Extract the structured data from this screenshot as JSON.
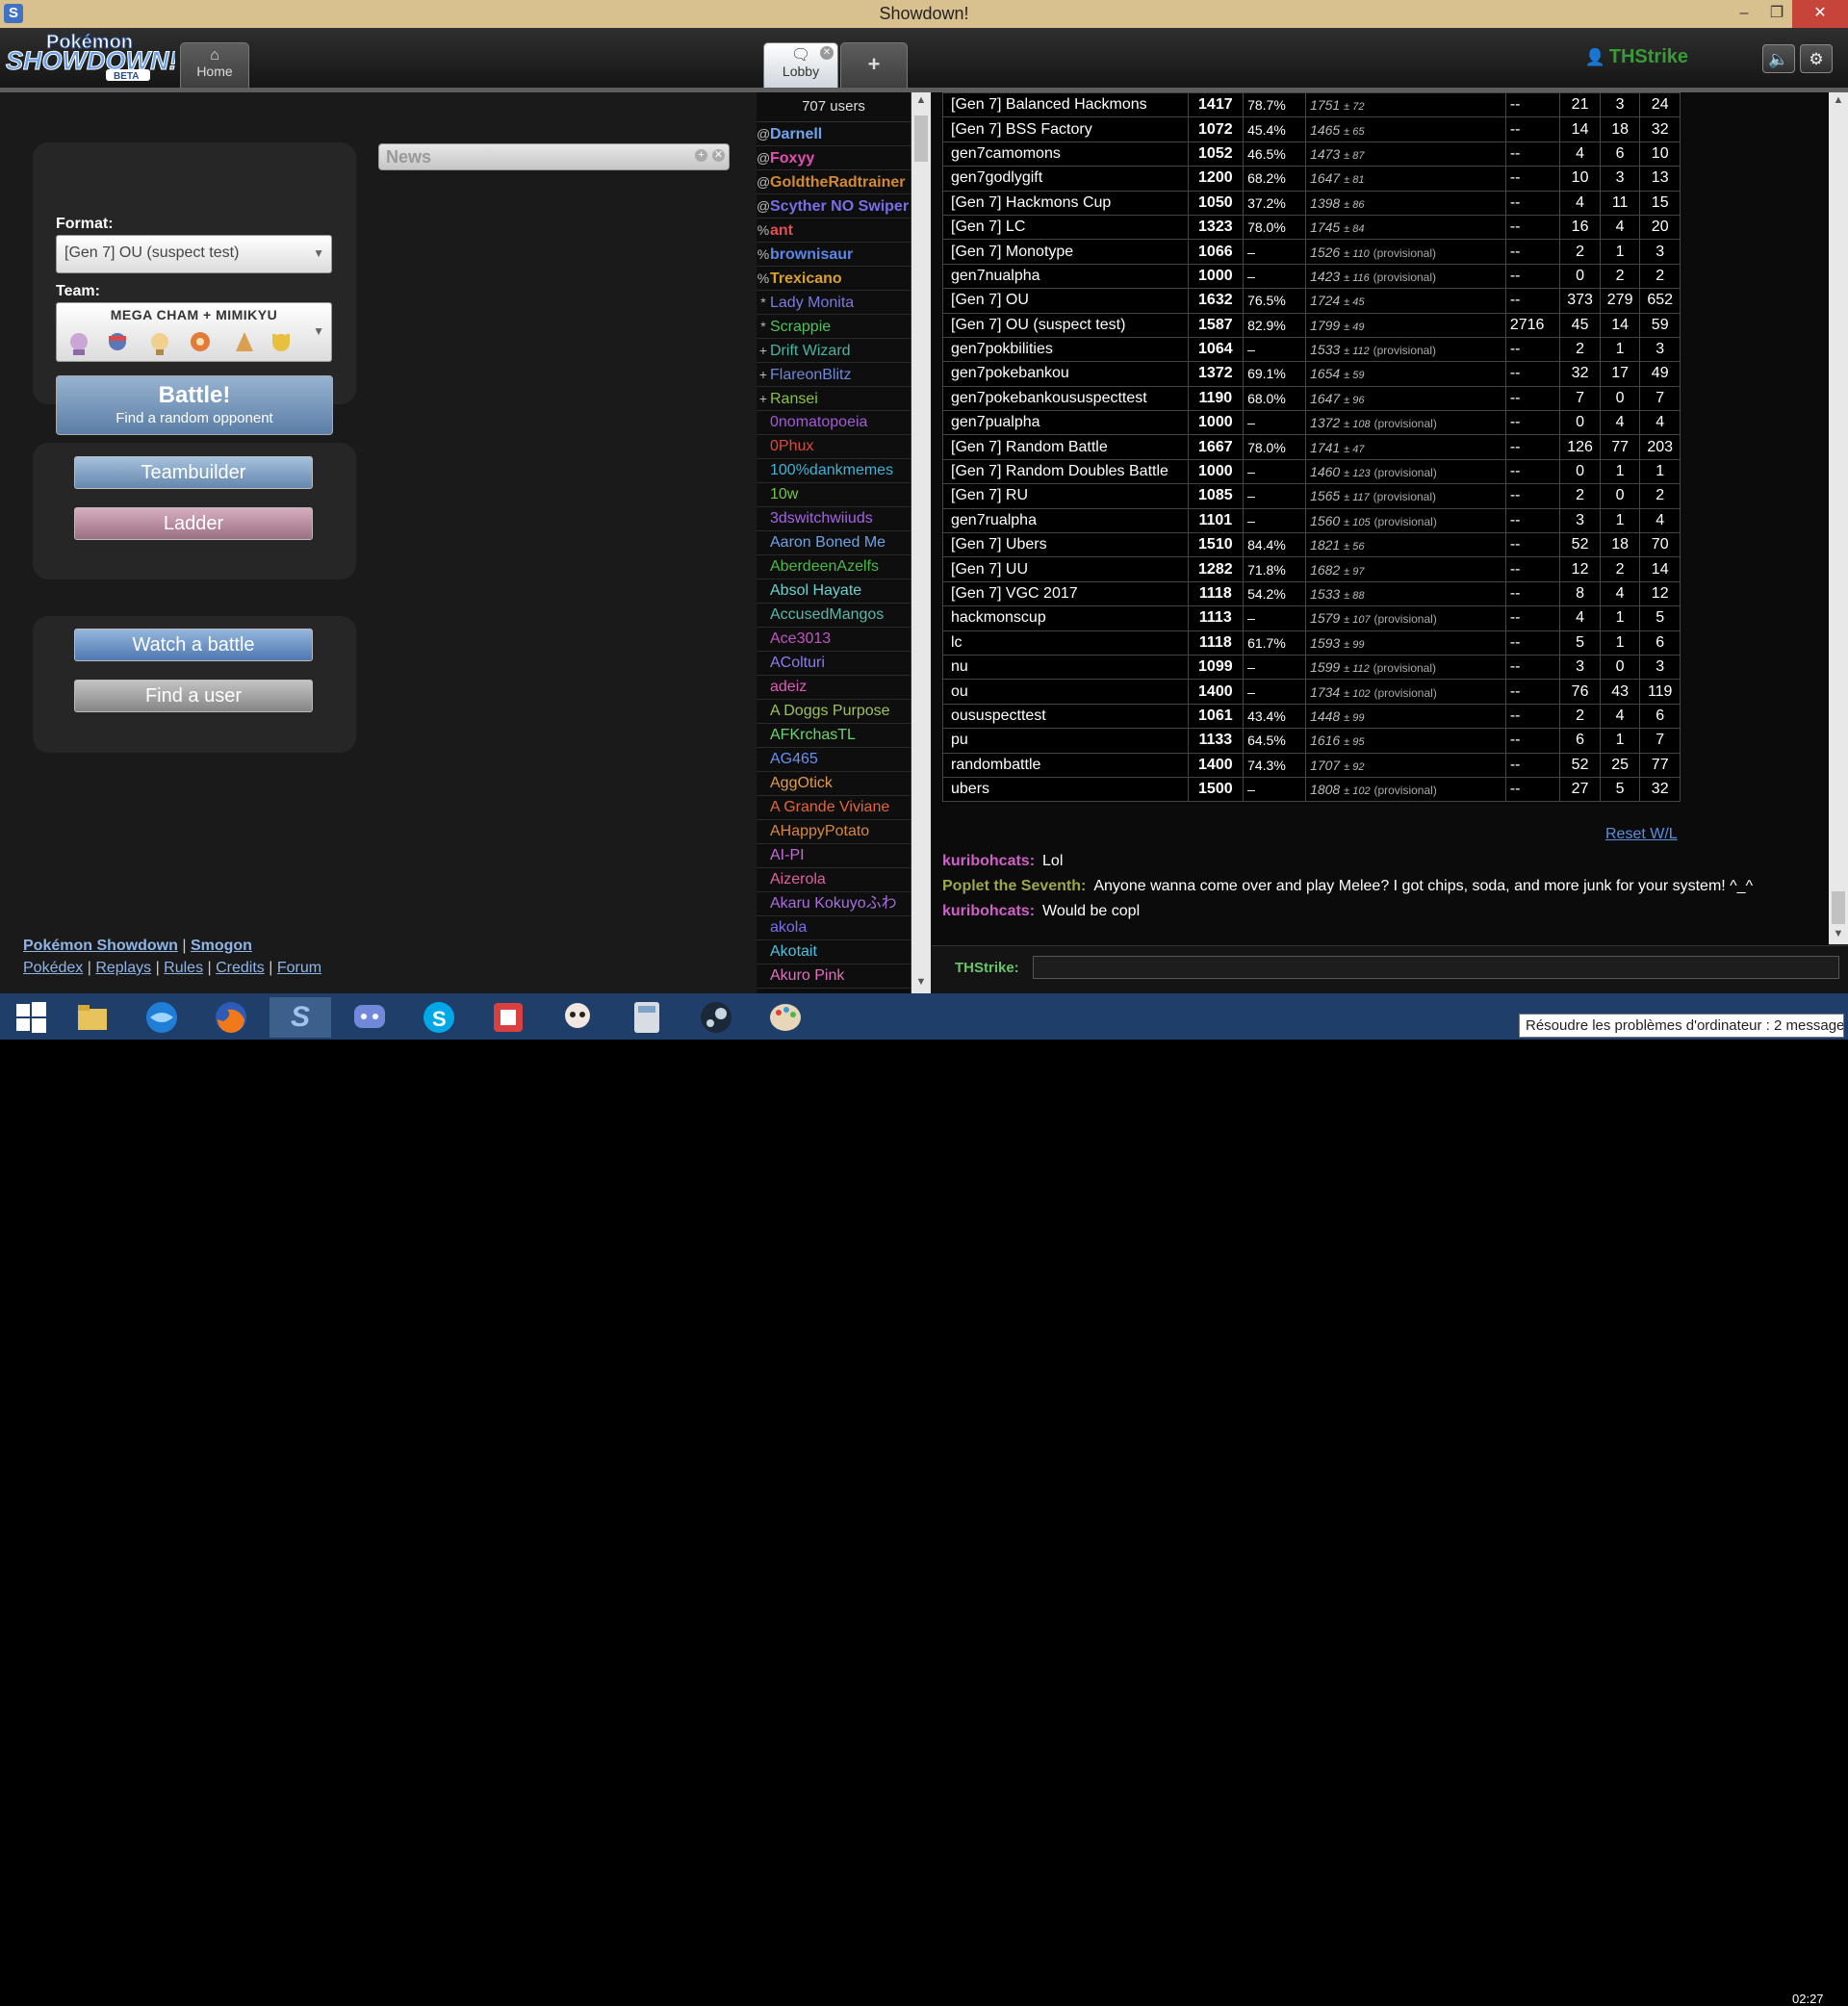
{
  "window": {
    "title": "Showdown!"
  },
  "header": {
    "logo_line1": "Pokémon",
    "logo_line2": "SHOWDOWN!",
    "logo_beta": "BETA",
    "tabs": [
      {
        "label": "Home",
        "icon": "home-icon"
      },
      {
        "label": "Lobby",
        "icon": "speech-bubble-icon"
      },
      {
        "label": "+",
        "icon": "plus-icon"
      }
    ],
    "username": "THStrike"
  },
  "home": {
    "format_label": "Format:",
    "format_value": "[Gen 7] OU (suspect test)",
    "team_label": "Team:",
    "team_name": "MEGA CHAM + MIMIKYU",
    "battle_label": "Battle!",
    "battle_sub": "Find a random opponent",
    "teambuilder": "Teambuilder",
    "ladder": "Ladder",
    "watch": "Watch a battle",
    "find_user": "Find a user",
    "news_title": "News"
  },
  "footer": {
    "links1": [
      "Pokémon Showdown",
      "Smogon"
    ],
    "links2": [
      "Pokédex",
      "Replays",
      "Rules",
      "Credits",
      "Forum"
    ]
  },
  "userlist": {
    "count": "707 users",
    "users": [
      {
        "rank": "@",
        "name": "Darnell",
        "color": "#6fa5f0",
        "bold": true
      },
      {
        "rank": "@",
        "name": "Foxyy",
        "color": "#e24fb0",
        "bold": true
      },
      {
        "rank": "@",
        "name": "GoldtheRadtrainer",
        "color": "#d48a2c",
        "bold": true
      },
      {
        "rank": "@",
        "name": "Scyther NO Swiper",
        "color": "#7a6ee8",
        "bold": true
      },
      {
        "rank": "%",
        "name": "ant",
        "color": "#e05050",
        "bold": true
      },
      {
        "rank": "%",
        "name": "brownisaur",
        "color": "#5a86e8",
        "bold": true
      },
      {
        "rank": "%",
        "name": "Trexicano",
        "color": "#d9a030",
        "bold": true
      },
      {
        "rank": "*",
        "name": "Lady Monita",
        "color": "#7a7ae0",
        "bold": false
      },
      {
        "rank": "*",
        "name": "Scrappie",
        "color": "#4fc15a",
        "bold": false
      },
      {
        "rank": "+",
        "name": "Drift Wizard",
        "color": "#46b5a4",
        "bold": false
      },
      {
        "rank": "+",
        "name": "FlareonBlitz",
        "color": "#6f87d8",
        "bold": false
      },
      {
        "rank": "+",
        "name": "Ransei",
        "color": "#88c14a",
        "bold": false
      },
      {
        "rank": "",
        "name": "0nomatopoeia",
        "color": "#a25bd6",
        "bold": false
      },
      {
        "rank": "",
        "name": "0Phux",
        "color": "#e0483c",
        "bold": false
      },
      {
        "rank": "",
        "name": "100%dankmemes",
        "color": "#3fb2d6",
        "bold": false
      },
      {
        "rank": "",
        "name": "10w",
        "color": "#76c24a",
        "bold": false
      },
      {
        "rank": "",
        "name": "3dswitchwiiuds",
        "color": "#a463e6",
        "bold": false
      },
      {
        "rank": "",
        "name": "Aaron Boned Me",
        "color": "#6aa4e8",
        "bold": false
      },
      {
        "rank": "",
        "name": "AberdeenAzelfs",
        "color": "#4ab84a",
        "bold": false
      },
      {
        "rank": "",
        "name": "Absol Hayate",
        "color": "#6ed0d0",
        "bold": false
      },
      {
        "rank": "",
        "name": "AccusedMangos",
        "color": "#59b8a8",
        "bold": false
      },
      {
        "rank": "",
        "name": "Ace3013",
        "color": "#c154c1",
        "bold": false
      },
      {
        "rank": "",
        "name": "AColturi",
        "color": "#8b7ee8",
        "bold": false
      },
      {
        "rank": "",
        "name": "adeiz",
        "color": "#e05ab8",
        "bold": false
      },
      {
        "rank": "",
        "name": "A Doggs Purpose",
        "color": "#9fc05c",
        "bold": false
      },
      {
        "rank": "",
        "name": "AFKrchasTL",
        "color": "#6fd06f",
        "bold": false
      },
      {
        "rank": "",
        "name": "AG465",
        "color": "#6d8ff0",
        "bold": false
      },
      {
        "rank": "",
        "name": "AggOtick",
        "color": "#e09a4a",
        "bold": false
      },
      {
        "rank": "",
        "name": "A Grande Viviane",
        "color": "#e0663c",
        "bold": false
      },
      {
        "rank": "",
        "name": "AHappyPotato",
        "color": "#d8893a",
        "bold": false
      },
      {
        "rank": "",
        "name": "AI-PI",
        "color": "#c56bd6",
        "bold": false
      },
      {
        "rank": "",
        "name": "Aizerola",
        "color": "#e060a0",
        "bold": false
      },
      {
        "rank": "",
        "name": "Akaru Kokuyoふわ",
        "color": "#a86ee0",
        "bold": false
      },
      {
        "rank": "",
        "name": "akola",
        "color": "#7a6fe8",
        "bold": false
      },
      {
        "rank": "",
        "name": "Akotait",
        "color": "#4fc0e0",
        "bold": false
      },
      {
        "rank": "",
        "name": "Akuro Pink",
        "color": "#e06fc0",
        "bold": false
      }
    ]
  },
  "ladder_table": {
    "rows": [
      {
        "format": "[Gen 7] Balanced Hackmons",
        "elo": "1417",
        "gxe": "78.7%",
        "glicko": "1751",
        "dev": "± 72",
        "prov": "",
        "coil": "--",
        "w": "21",
        "l": "3",
        "t": "24"
      },
      {
        "format": "[Gen 7] BSS Factory",
        "elo": "1072",
        "gxe": "45.4%",
        "glicko": "1465",
        "dev": "± 65",
        "prov": "",
        "coil": "--",
        "w": "14",
        "l": "18",
        "t": "32"
      },
      {
        "format": "gen7camomons",
        "elo": "1052",
        "gxe": "46.5%",
        "glicko": "1473",
        "dev": "± 87",
        "prov": "",
        "coil": "--",
        "w": "4",
        "l": "6",
        "t": "10"
      },
      {
        "format": "gen7godlygift",
        "elo": "1200",
        "gxe": "68.2%",
        "glicko": "1647",
        "dev": "± 81",
        "prov": "",
        "coil": "--",
        "w": "10",
        "l": "3",
        "t": "13"
      },
      {
        "format": "[Gen 7] Hackmons Cup",
        "elo": "1050",
        "gxe": "37.2%",
        "glicko": "1398",
        "dev": "± 86",
        "prov": "",
        "coil": "--",
        "w": "4",
        "l": "11",
        "t": "15"
      },
      {
        "format": "[Gen 7] LC",
        "elo": "1323",
        "gxe": "78.0%",
        "glicko": "1745",
        "dev": "± 84",
        "prov": "",
        "coil": "--",
        "w": "16",
        "l": "4",
        "t": "20"
      },
      {
        "format": "[Gen 7] Monotype",
        "elo": "1066",
        "gxe": "–",
        "glicko": "1526",
        "dev": "± 110",
        "prov": "(provisional)",
        "coil": "--",
        "w": "2",
        "l": "1",
        "t": "3"
      },
      {
        "format": "gen7nualpha",
        "elo": "1000",
        "gxe": "–",
        "glicko": "1423",
        "dev": "± 116",
        "prov": "(provisional)",
        "coil": "--",
        "w": "0",
        "l": "2",
        "t": "2"
      },
      {
        "format": "[Gen 7] OU",
        "elo": "1632",
        "gxe": "76.5%",
        "glicko": "1724",
        "dev": "± 45",
        "prov": "",
        "coil": "--",
        "w": "373",
        "l": "279",
        "t": "652"
      },
      {
        "format": "[Gen 7] OU (suspect test)",
        "elo": "1587",
        "gxe": "82.9%",
        "glicko": "1799",
        "dev": "± 49",
        "prov": "",
        "coil": "2716",
        "w": "45",
        "l": "14",
        "t": "59"
      },
      {
        "format": "gen7pokbilities",
        "elo": "1064",
        "gxe": "–",
        "glicko": "1533",
        "dev": "± 112",
        "prov": "(provisional)",
        "coil": "--",
        "w": "2",
        "l": "1",
        "t": "3"
      },
      {
        "format": "gen7pokebankou",
        "elo": "1372",
        "gxe": "69.1%",
        "glicko": "1654",
        "dev": "± 59",
        "prov": "",
        "coil": "--",
        "w": "32",
        "l": "17",
        "t": "49"
      },
      {
        "format": "gen7pokebankoususpecttest",
        "elo": "1190",
        "gxe": "68.0%",
        "glicko": "1647",
        "dev": "± 96",
        "prov": "",
        "coil": "--",
        "w": "7",
        "l": "0",
        "t": "7"
      },
      {
        "format": "gen7pualpha",
        "elo": "1000",
        "gxe": "–",
        "glicko": "1372",
        "dev": "± 108",
        "prov": "(provisional)",
        "coil": "--",
        "w": "0",
        "l": "4",
        "t": "4"
      },
      {
        "format": "[Gen 7] Random Battle",
        "elo": "1667",
        "gxe": "78.0%",
        "glicko": "1741",
        "dev": "± 47",
        "prov": "",
        "coil": "--",
        "w": "126",
        "l": "77",
        "t": "203"
      },
      {
        "format": "[Gen 7] Random Doubles Battle",
        "elo": "1000",
        "gxe": "–",
        "glicko": "1460",
        "dev": "± 123",
        "prov": "(provisional)",
        "coil": "--",
        "w": "0",
        "l": "1",
        "t": "1"
      },
      {
        "format": "[Gen 7] RU",
        "elo": "1085",
        "gxe": "–",
        "glicko": "1565",
        "dev": "± 117",
        "prov": "(provisional)",
        "coil": "--",
        "w": "2",
        "l": "0",
        "t": "2"
      },
      {
        "format": "gen7rualpha",
        "elo": "1101",
        "gxe": "–",
        "glicko": "1560",
        "dev": "± 105",
        "prov": "(provisional)",
        "coil": "--",
        "w": "3",
        "l": "1",
        "t": "4"
      },
      {
        "format": "[Gen 7] Ubers",
        "elo": "1510",
        "gxe": "84.4%",
        "glicko": "1821",
        "dev": "± 56",
        "prov": "",
        "coil": "--",
        "w": "52",
        "l": "18",
        "t": "70"
      },
      {
        "format": "[Gen 7] UU",
        "elo": "1282",
        "gxe": "71.8%",
        "glicko": "1682",
        "dev": "± 97",
        "prov": "",
        "coil": "--",
        "w": "12",
        "l": "2",
        "t": "14"
      },
      {
        "format": "[Gen 7] VGC 2017",
        "elo": "1118",
        "gxe": "54.2%",
        "glicko": "1533",
        "dev": "± 88",
        "prov": "",
        "coil": "--",
        "w": "8",
        "l": "4",
        "t": "12"
      },
      {
        "format": "hackmonscup",
        "elo": "1113",
        "gxe": "–",
        "glicko": "1579",
        "dev": "± 107",
        "prov": "(provisional)",
        "coil": "--",
        "w": "4",
        "l": "1",
        "t": "5"
      },
      {
        "format": "lc",
        "elo": "1118",
        "gxe": "61.7%",
        "glicko": "1593",
        "dev": "± 99",
        "prov": "",
        "coil": "--",
        "w": "5",
        "l": "1",
        "t": "6"
      },
      {
        "format": "nu",
        "elo": "1099",
        "gxe": "–",
        "glicko": "1599",
        "dev": "± 112",
        "prov": "(provisional)",
        "coil": "--",
        "w": "3",
        "l": "0",
        "t": "3"
      },
      {
        "format": "ou",
        "elo": "1400",
        "gxe": "–",
        "glicko": "1734",
        "dev": "± 102",
        "prov": "(provisional)",
        "coil": "--",
        "w": "76",
        "l": "43",
        "t": "119"
      },
      {
        "format": "oususpecttest",
        "elo": "1061",
        "gxe": "43.4%",
        "glicko": "1448",
        "dev": "± 99",
        "prov": "",
        "coil": "--",
        "w": "2",
        "l": "4",
        "t": "6"
      },
      {
        "format": "pu",
        "elo": "1133",
        "gxe": "64.5%",
        "glicko": "1616",
        "dev": "± 95",
        "prov": "",
        "coil": "--",
        "w": "6",
        "l": "1",
        "t": "7"
      },
      {
        "format": "randombattle",
        "elo": "1400",
        "gxe": "74.3%",
        "glicko": "1707",
        "dev": "± 92",
        "prov": "",
        "coil": "--",
        "w": "52",
        "l": "25",
        "t": "77"
      },
      {
        "format": "ubers",
        "elo": "1500",
        "gxe": "–",
        "glicko": "1808",
        "dev": "± 102",
        "prov": "(provisional)",
        "coil": "--",
        "w": "27",
        "l": "5",
        "t": "32"
      }
    ],
    "reset": "Reset W/L"
  },
  "chat": {
    "messages": [
      {
        "user": "kuribohcats:",
        "color": "#d060c8",
        "text": "Lol"
      },
      {
        "user": "Poplet the Seventh:",
        "color": "#9ea848",
        "text": "Anyone wanna come over and play Melee? I got chips, soda, and more junk for your system! ^_^"
      },
      {
        "user": "kuribohcats:",
        "color": "#d060c8",
        "text": "Would be copl"
      }
    ],
    "input_label": "THStrike:"
  },
  "taskbar": {
    "icons": [
      "windows-start-icon",
      "file-explorer-icon",
      "browser-swirl-icon",
      "firefox-icon",
      "showdown-icon",
      "discord-icon",
      "skype-icon",
      "notes-app-icon",
      "game-character-icon",
      "calculator-icon",
      "steam-icon",
      "paint-icon"
    ],
    "notification": "Résoudre les problèmes d'ordinateur : 2 messages",
    "clock": "02:27"
  }
}
